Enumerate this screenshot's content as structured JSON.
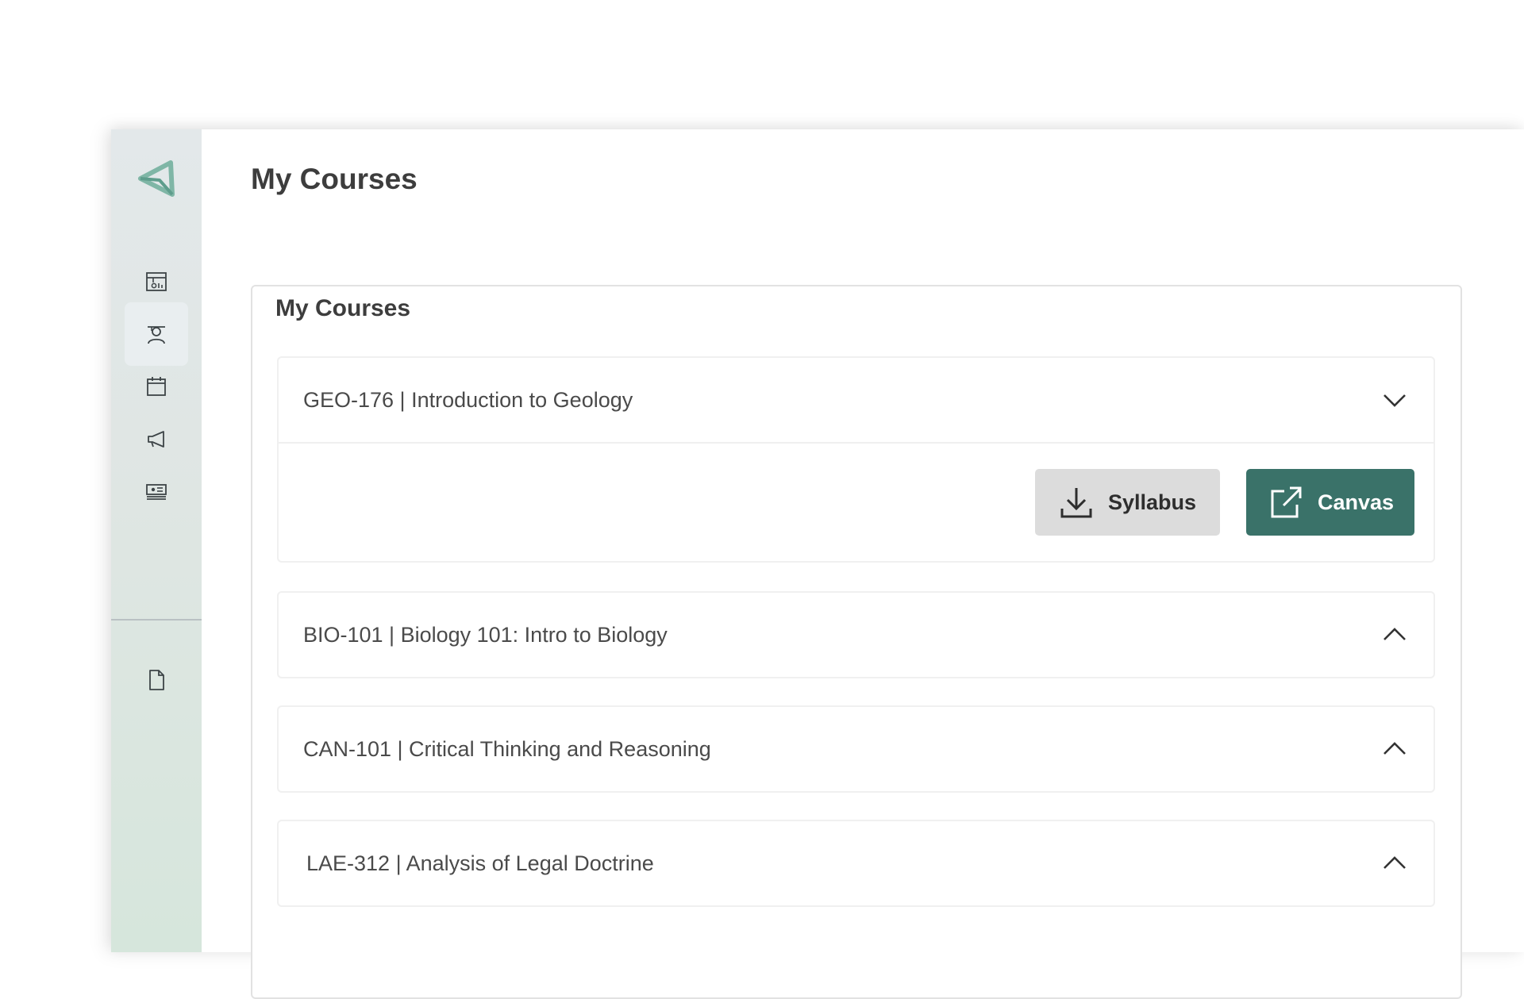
{
  "page": {
    "title": "My Courses"
  },
  "sidebar": {
    "logo_icon": "paper-plane-logo",
    "items": [
      {
        "icon": "dashboard-icon",
        "active": false
      },
      {
        "icon": "student-icon",
        "active": true
      },
      {
        "icon": "calendar-icon",
        "active": false
      },
      {
        "icon": "megaphone-icon",
        "active": false
      },
      {
        "icon": "id-card-icon",
        "active": false
      },
      {
        "icon": "document-icon",
        "active": false
      }
    ]
  },
  "panel": {
    "title": "My Courses",
    "courses": [
      {
        "name": "GEO-176 | Introduction to Geology",
        "expanded": true,
        "chevron": "chevron-down-icon"
      },
      {
        "name": "BIO-101 | Biology 101: Intro to Biology",
        "expanded": false,
        "chevron": "chevron-up-icon"
      },
      {
        "name": "CAN-101 | Critical Thinking and Reasoning",
        "expanded": false,
        "chevron": "chevron-up-icon"
      },
      {
        "name": "LAE-312 | Analysis of Legal Doctrine",
        "expanded": false,
        "chevron": "chevron-up-icon"
      }
    ],
    "syllabus_label": "Syllabus",
    "canvas_label": "Canvas"
  },
  "colors": {
    "accent": "#3a7269",
    "logo": "#7fb6a6",
    "syllabus_bg": "#dcdcdc"
  }
}
